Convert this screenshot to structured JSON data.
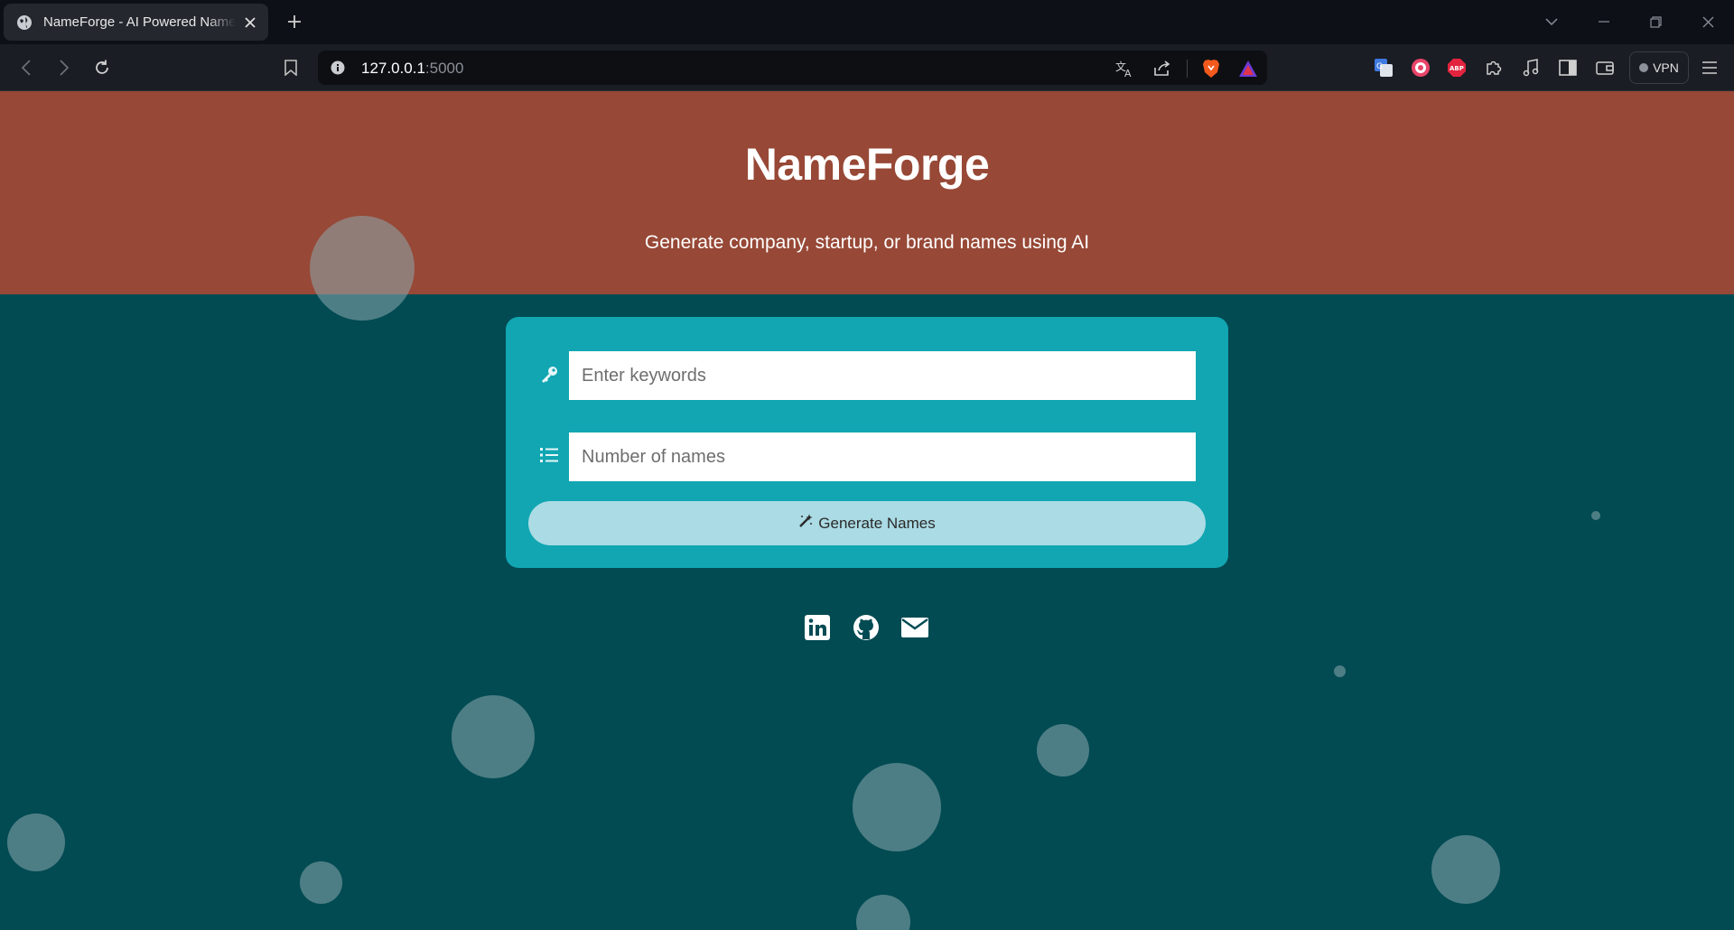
{
  "browser": {
    "tab_title": "NameForge - AI Powered Name Generator",
    "url_host": "127.0.0.1",
    "url_port": ":5000",
    "vpn_label": "VPN",
    "extensions": [
      "translate-icon",
      "record-icon",
      "adblock-icon",
      "puzzle-icon",
      "music-icon",
      "sidebar-icon",
      "wallet-icon"
    ]
  },
  "hero": {
    "title": "NameForge",
    "subtitle": "Generate company, startup, or brand names using AI",
    "background": "#974836"
  },
  "form": {
    "keywords_placeholder": "Enter keywords",
    "count_placeholder": "Number of names",
    "generate_label": "Generate Names",
    "card_color": "#11a6b2",
    "button_color": "#abdbe4"
  },
  "socials": [
    "linkedin-icon",
    "github-icon",
    "mail-icon"
  ],
  "colors": {
    "page_background": "#034b53",
    "accent": "#11a6b2"
  }
}
